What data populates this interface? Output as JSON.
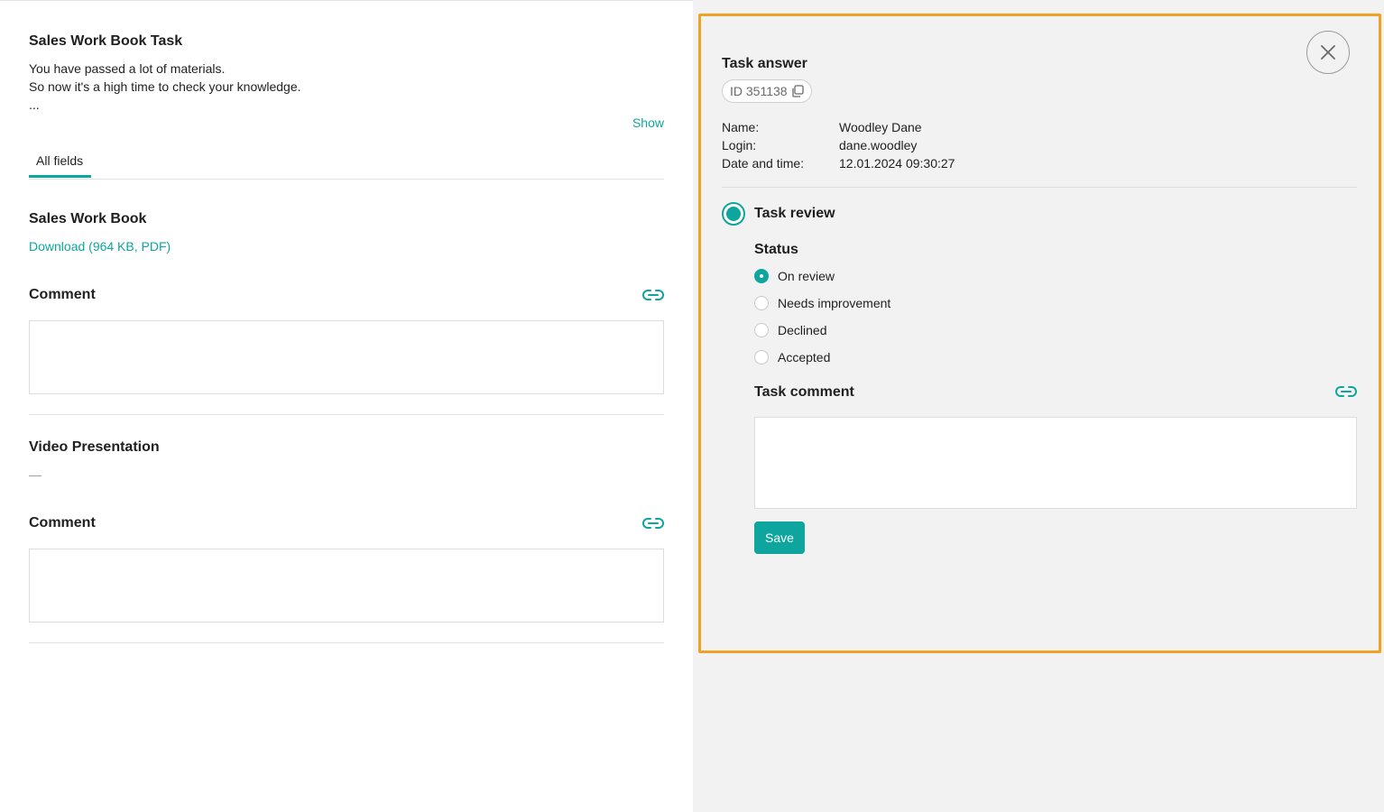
{
  "left": {
    "task_title": "Sales Work Book Task",
    "description_line1": "You have passed a lot of materials.",
    "description_line2": "So now it's a high time to check your knowledge.",
    "description_more": "...",
    "show_link": "Show",
    "tab_all_fields": "All fields",
    "field1_title": "Sales Work Book",
    "field1_download": "Download (964 KB, PDF)",
    "comment1_label": "Comment",
    "field2_title": "Video Presentation",
    "field2_value": "—",
    "comment2_label": "Comment"
  },
  "panel": {
    "title": "Task answer",
    "id_label": "ID 351138",
    "name_label": "Name:",
    "name_value": "Woodley Dane",
    "login_label": "Login:",
    "login_value": "dane.woodley",
    "datetime_label": "Date and time:",
    "datetime_value": "12.01.2024 09:30:27",
    "review_title": "Task review",
    "status_label": "Status",
    "status_options": [
      "On review",
      "Needs improvement",
      "Declined",
      "Accepted"
    ],
    "selected_status": "On review",
    "task_comment_label": "Task comment",
    "save_label": "Save"
  },
  "icons": {
    "copy": "copy-icon",
    "link": "link-icon",
    "close": "close-icon"
  },
  "colors": {
    "accent": "#0ea59f",
    "highlight_border": "#f0a224"
  }
}
